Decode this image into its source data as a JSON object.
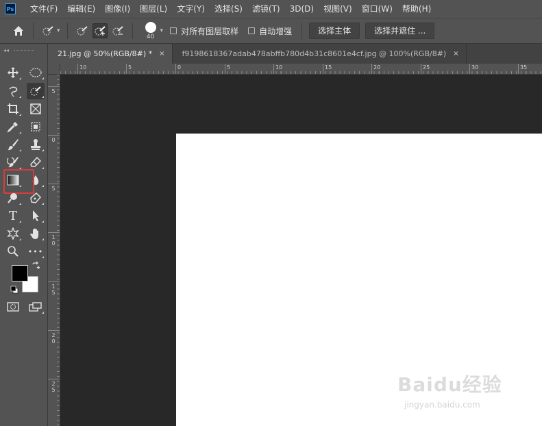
{
  "app": {
    "logo_text": "Ps"
  },
  "menu": [
    "文件(F)",
    "编辑(E)",
    "图像(I)",
    "图层(L)",
    "文字(Y)",
    "选择(S)",
    "滤镜(T)",
    "3D(D)",
    "视图(V)",
    "窗口(W)",
    "帮助(H)"
  ],
  "options": {
    "brush_size": "40",
    "sample_all_layers_label": "对所有图层取样",
    "sample_all_layers_checked": false,
    "auto_enhance_label": "自动增强",
    "auto_enhance_checked": false,
    "select_subject_label": "选择主体",
    "select_and_mask_label": "选择并遮住 ..."
  },
  "toolbar": {
    "collapse_glyph": "◂◂",
    "type_tool_glyph": "T",
    "more_glyph": "•••",
    "selected_tool": "quick-selection",
    "highlighted_tool": "gradient",
    "foreground_color": "#000000",
    "background_color": "#ffffff",
    "highlight_color": "#d93c3c"
  },
  "tabs": [
    {
      "label": "21.jpg @ 50%(RGB/8#) *",
      "active": true,
      "close": "×"
    },
    {
      "label": "f9198618367adab478abffb780d4b31c8601e4cf.jpg @ 100%(RGB/8#)",
      "active": false,
      "close": "×"
    }
  ],
  "ruler_top": [
    "10",
    "5",
    "0",
    "5",
    "10",
    "15",
    "20",
    "25",
    "30",
    "35"
  ],
  "ruler_left": [
    "5",
    "0",
    "5",
    "10",
    "15",
    "20",
    "25"
  ],
  "watermark": {
    "brand": "Baidu经验",
    "url": "jingyan.baidu.com"
  }
}
